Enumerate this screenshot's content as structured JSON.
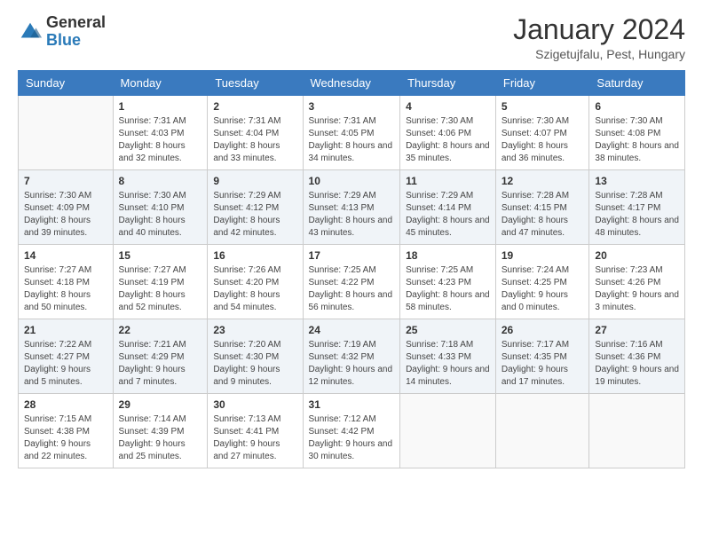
{
  "header": {
    "logo_general": "General",
    "logo_blue": "Blue",
    "month_title": "January 2024",
    "location": "Szigetujfalu, Pest, Hungary"
  },
  "weekdays": [
    "Sunday",
    "Monday",
    "Tuesday",
    "Wednesday",
    "Thursday",
    "Friday",
    "Saturday"
  ],
  "weeks": [
    [
      {
        "day": "",
        "sunrise": "",
        "sunset": "",
        "daylight": ""
      },
      {
        "day": "1",
        "sunrise": "7:31 AM",
        "sunset": "4:03 PM",
        "daylight": "8 hours and 32 minutes."
      },
      {
        "day": "2",
        "sunrise": "7:31 AM",
        "sunset": "4:04 PM",
        "daylight": "8 hours and 33 minutes."
      },
      {
        "day": "3",
        "sunrise": "7:31 AM",
        "sunset": "4:05 PM",
        "daylight": "8 hours and 34 minutes."
      },
      {
        "day": "4",
        "sunrise": "7:30 AM",
        "sunset": "4:06 PM",
        "daylight": "8 hours and 35 minutes."
      },
      {
        "day": "5",
        "sunrise": "7:30 AM",
        "sunset": "4:07 PM",
        "daylight": "8 hours and 36 minutes."
      },
      {
        "day": "6",
        "sunrise": "7:30 AM",
        "sunset": "4:08 PM",
        "daylight": "8 hours and 38 minutes."
      }
    ],
    [
      {
        "day": "7",
        "sunrise": "7:30 AM",
        "sunset": "4:09 PM",
        "daylight": "8 hours and 39 minutes."
      },
      {
        "day": "8",
        "sunrise": "7:30 AM",
        "sunset": "4:10 PM",
        "daylight": "8 hours and 40 minutes."
      },
      {
        "day": "9",
        "sunrise": "7:29 AM",
        "sunset": "4:12 PM",
        "daylight": "8 hours and 42 minutes."
      },
      {
        "day": "10",
        "sunrise": "7:29 AM",
        "sunset": "4:13 PM",
        "daylight": "8 hours and 43 minutes."
      },
      {
        "day": "11",
        "sunrise": "7:29 AM",
        "sunset": "4:14 PM",
        "daylight": "8 hours and 45 minutes."
      },
      {
        "day": "12",
        "sunrise": "7:28 AM",
        "sunset": "4:15 PM",
        "daylight": "8 hours and 47 minutes."
      },
      {
        "day": "13",
        "sunrise": "7:28 AM",
        "sunset": "4:17 PM",
        "daylight": "8 hours and 48 minutes."
      }
    ],
    [
      {
        "day": "14",
        "sunrise": "7:27 AM",
        "sunset": "4:18 PM",
        "daylight": "8 hours and 50 minutes."
      },
      {
        "day": "15",
        "sunrise": "7:27 AM",
        "sunset": "4:19 PM",
        "daylight": "8 hours and 52 minutes."
      },
      {
        "day": "16",
        "sunrise": "7:26 AM",
        "sunset": "4:20 PM",
        "daylight": "8 hours and 54 minutes."
      },
      {
        "day": "17",
        "sunrise": "7:25 AM",
        "sunset": "4:22 PM",
        "daylight": "8 hours and 56 minutes."
      },
      {
        "day": "18",
        "sunrise": "7:25 AM",
        "sunset": "4:23 PM",
        "daylight": "8 hours and 58 minutes."
      },
      {
        "day": "19",
        "sunrise": "7:24 AM",
        "sunset": "4:25 PM",
        "daylight": "9 hours and 0 minutes."
      },
      {
        "day": "20",
        "sunrise": "7:23 AM",
        "sunset": "4:26 PM",
        "daylight": "9 hours and 3 minutes."
      }
    ],
    [
      {
        "day": "21",
        "sunrise": "7:22 AM",
        "sunset": "4:27 PM",
        "daylight": "9 hours and 5 minutes."
      },
      {
        "day": "22",
        "sunrise": "7:21 AM",
        "sunset": "4:29 PM",
        "daylight": "9 hours and 7 minutes."
      },
      {
        "day": "23",
        "sunrise": "7:20 AM",
        "sunset": "4:30 PM",
        "daylight": "9 hours and 9 minutes."
      },
      {
        "day": "24",
        "sunrise": "7:19 AM",
        "sunset": "4:32 PM",
        "daylight": "9 hours and 12 minutes."
      },
      {
        "day": "25",
        "sunrise": "7:18 AM",
        "sunset": "4:33 PM",
        "daylight": "9 hours and 14 minutes."
      },
      {
        "day": "26",
        "sunrise": "7:17 AM",
        "sunset": "4:35 PM",
        "daylight": "9 hours and 17 minutes."
      },
      {
        "day": "27",
        "sunrise": "7:16 AM",
        "sunset": "4:36 PM",
        "daylight": "9 hours and 19 minutes."
      }
    ],
    [
      {
        "day": "28",
        "sunrise": "7:15 AM",
        "sunset": "4:38 PM",
        "daylight": "9 hours and 22 minutes."
      },
      {
        "day": "29",
        "sunrise": "7:14 AM",
        "sunset": "4:39 PM",
        "daylight": "9 hours and 25 minutes."
      },
      {
        "day": "30",
        "sunrise": "7:13 AM",
        "sunset": "4:41 PM",
        "daylight": "9 hours and 27 minutes."
      },
      {
        "day": "31",
        "sunrise": "7:12 AM",
        "sunset": "4:42 PM",
        "daylight": "9 hours and 30 minutes."
      },
      {
        "day": "",
        "sunrise": "",
        "sunset": "",
        "daylight": ""
      },
      {
        "day": "",
        "sunrise": "",
        "sunset": "",
        "daylight": ""
      },
      {
        "day": "",
        "sunrise": "",
        "sunset": "",
        "daylight": ""
      }
    ]
  ],
  "labels": {
    "sunrise_prefix": "Sunrise: ",
    "sunset_prefix": "Sunset: ",
    "daylight_prefix": "Daylight: "
  }
}
